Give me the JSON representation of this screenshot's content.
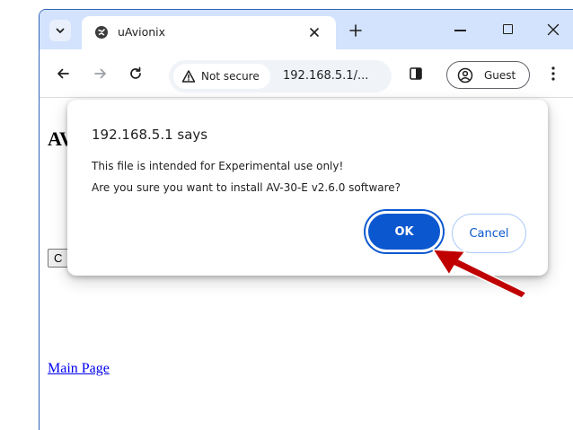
{
  "browser": {
    "tab_title": "uAvionix",
    "security_label": "Not secure",
    "url": "192.168.5.1/...",
    "profile_label": "Guest"
  },
  "page": {
    "heading_visible": "AV",
    "button_visible": "C",
    "link_text": "Main Page"
  },
  "dialog": {
    "title": "192.168.5.1 says",
    "message_line1": "This file is intended for Experimental use only!",
    "message_line2": "Are you sure you want to install AV-30-E v2.6.0 software?",
    "ok_label": "OK",
    "cancel_label": "Cancel"
  },
  "colors": {
    "tab_strip": "#d3e3fd",
    "accent_blue": "#0b57d0",
    "annotation_arrow": "#c00000",
    "link": "#0000ee"
  },
  "icons": [
    "chevron-down-icon",
    "favicon-icon",
    "close-icon",
    "plus-icon",
    "minimize-icon",
    "maximize-icon",
    "back-arrow-icon",
    "forward-arrow-icon",
    "reload-icon",
    "warning-icon",
    "side-panel-icon",
    "profile-icon",
    "more-vert-icon",
    "annotation-arrow-icon"
  ]
}
